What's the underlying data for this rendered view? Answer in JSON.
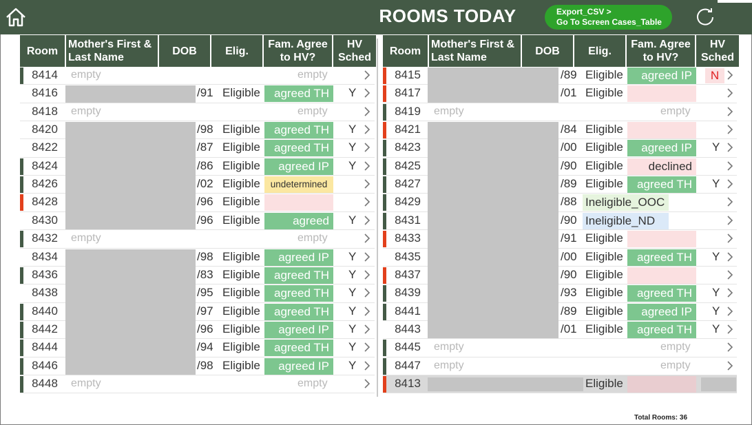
{
  "header": {
    "title": "ROOMS TODAY",
    "nav_button_line1": "Export_CSV >",
    "nav_button_line2": "Go To Screen Cases_Table"
  },
  "columns": {
    "room": "Room",
    "mother": "Mother's First & Last Name",
    "dob": "DOB",
    "elig": "Elig.",
    "fam": "Fam. Agree to HV?",
    "hv": "HV Sched"
  },
  "left": {
    "rows": [
      {
        "room": "8414",
        "empty": true,
        "mark": "#445a46"
      },
      {
        "room": "8416",
        "dob": "/91",
        "elig": "Eligible",
        "fam": "agreed TH",
        "famType": "green",
        "hv": "Y",
        "mark": ""
      },
      {
        "room": "8418",
        "empty": true,
        "mark": ""
      },
      {
        "room": "8420",
        "dob": "/98",
        "elig": "Eligible",
        "fam": "agreed TH",
        "famType": "green",
        "hv": "Y",
        "mark": ""
      },
      {
        "room": "8422",
        "dob": "/87",
        "elig": "Eligible",
        "fam": "agreed TH",
        "famType": "green",
        "hv": "Y",
        "mark": ""
      },
      {
        "room": "8424",
        "dob": "/86",
        "elig": "Eligible",
        "fam": "agreed  IP",
        "famType": "green",
        "hv": "Y",
        "mark": "#445a46"
      },
      {
        "room": "8426",
        "dob": "/02",
        "elig": "Eligible",
        "fam": "undetermined",
        "famType": "yellow",
        "hv": "",
        "mark": "#445a46"
      },
      {
        "room": "8428",
        "dob": "/96",
        "elig": "Eligible",
        "fam": "",
        "famType": "pink",
        "hv": "",
        "mark": "#e2401c"
      },
      {
        "room": "8430",
        "dob": "/96",
        "elig": "Eligible",
        "fam": "agreed",
        "famType": "green",
        "hv": "Y",
        "mark": ""
      },
      {
        "room": "8432",
        "empty": true,
        "mark": "#445a46"
      },
      {
        "room": "8434",
        "dob": "/98",
        "elig": "Eligible",
        "fam": "agreed  IP",
        "famType": "green",
        "hv": "Y",
        "mark": ""
      },
      {
        "room": "8436",
        "dob": "/83",
        "elig": "Eligible",
        "fam": "agreed TH",
        "famType": "green",
        "hv": "Y",
        "mark": "#445a46"
      },
      {
        "room": "8438",
        "dob": "/95",
        "elig": "Eligible",
        "fam": "agreed TH",
        "famType": "green",
        "hv": "Y",
        "mark": ""
      },
      {
        "room": "8440",
        "dob": "/97",
        "elig": "Eligible",
        "fam": "agreed TH",
        "famType": "green",
        "hv": "Y",
        "mark": "#445a46"
      },
      {
        "room": "8442",
        "dob": "/96",
        "elig": "Eligible",
        "fam": "agreed  IP",
        "famType": "green",
        "hv": "Y",
        "mark": "#445a46"
      },
      {
        "room": "8444",
        "dob": "/94",
        "elig": "Eligible",
        "fam": "agreed TH",
        "famType": "green",
        "hv": "Y",
        "mark": "#445a46"
      },
      {
        "room": "8446",
        "dob": "/98",
        "elig": "Eligible",
        "fam": "agreed  IP",
        "famType": "green",
        "hv": "Y",
        "mark": "#445a46"
      },
      {
        "room": "8448",
        "empty": true,
        "mark": "#445a46"
      }
    ]
  },
  "right": {
    "rows": [
      {
        "room": "8415",
        "dob": "/89",
        "elig": "Eligible",
        "fam": "agreed  IP",
        "famType": "green",
        "hv": "N",
        "hvRed": true,
        "mark": "#e2401c"
      },
      {
        "room": "8417",
        "dob": "/01",
        "elig": "Eligible",
        "fam": "",
        "famType": "pink",
        "hv": "",
        "mark": "#e2401c"
      },
      {
        "room": "8419",
        "empty": true,
        "mark": "#445a46"
      },
      {
        "room": "8421",
        "dob": "/84",
        "elig": "Eligible",
        "fam": "",
        "famType": "pink",
        "hv": "",
        "mark": "#e2401c"
      },
      {
        "room": "8423",
        "dob": "/00",
        "elig": "Eligible",
        "fam": "agreed  IP",
        "famType": "green",
        "hv": "Y",
        "mark": "#445a46"
      },
      {
        "room": "8425",
        "dob": "/90",
        "elig": "Eligible",
        "fam": "declined",
        "famType": "declined",
        "hv": "",
        "mark": "#445a46"
      },
      {
        "room": "8427",
        "dob": "/89",
        "elig": "Eligible",
        "fam": "agreed TH",
        "famType": "green",
        "hv": "Y",
        "mark": "#445a46"
      },
      {
        "room": "8429",
        "dob": "/88",
        "elig": "Ineligible_OOC",
        "eligType": "ooc",
        "fam": "",
        "famType": "none",
        "hv": "",
        "mark": "#445a46"
      },
      {
        "room": "8431",
        "dob": "/90",
        "elig": "Ineligible_ND",
        "eligType": "nd",
        "fam": "",
        "famType": "none",
        "hv": "",
        "mark": "#445a46"
      },
      {
        "room": "8433",
        "dob": "/91",
        "elig": "Eligible",
        "fam": "",
        "famType": "pink",
        "hv": "",
        "mark": "#e2401c"
      },
      {
        "room": "8435",
        "dob": "/00",
        "elig": "Eligible",
        "fam": "agreed TH",
        "famType": "green",
        "hv": "Y",
        "mark": ""
      },
      {
        "room": "8437",
        "dob": "/90",
        "elig": "Eligible",
        "fam": "",
        "famType": "pink",
        "hv": "",
        "mark": "#e2401c"
      },
      {
        "room": "8439",
        "dob": "/93",
        "elig": "Eligible",
        "fam": "agreed TH",
        "famType": "green",
        "hv": "Y",
        "mark": "#445a46"
      },
      {
        "room": "8441",
        "dob": "/89",
        "elig": "Eligible",
        "fam": "agreed  IP",
        "famType": "green",
        "hv": "Y",
        "mark": "#445a46"
      },
      {
        "room": "8443",
        "dob": "/01",
        "elig": "Eligible",
        "fam": "agreed TH",
        "famType": "green",
        "hv": "Y",
        "mark": ""
      },
      {
        "room": "8445",
        "empty": true,
        "mark": "#445a46"
      },
      {
        "room": "8447",
        "empty": true,
        "mark": "#445a46"
      },
      {
        "room": "8413",
        "dob": "",
        "elig": "Eligible",
        "fam": "",
        "famType": "selected",
        "hv": "",
        "mark": "#e2401c",
        "highlight": true
      }
    ]
  },
  "empty_label": "empty",
  "footer": {
    "total_rooms": "Total Rooms: 36"
  },
  "colors": {
    "header_bg": "#445a46",
    "accent_green": "#2ea32b",
    "status_red": "#e2401c",
    "agreed_green": "#7dc68f"
  }
}
